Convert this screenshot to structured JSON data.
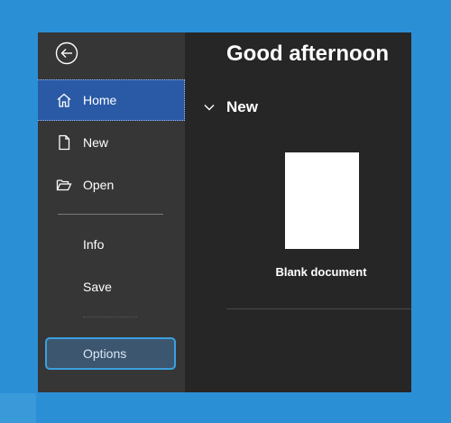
{
  "colors": {
    "page_background": "#2b8fd6",
    "sidebar_background": "#363636",
    "main_background": "#262626",
    "active_item": "#2a5aa6",
    "options_highlight_border": "#3aa0e0"
  },
  "sidebar": {
    "back_icon": "back-arrow-circle-icon",
    "items": [
      {
        "label": "Home",
        "icon": "home-icon"
      },
      {
        "label": "New",
        "icon": "new-document-icon"
      },
      {
        "label": "Open",
        "icon": "open-folder-icon"
      }
    ],
    "secondary_items": [
      {
        "label": "Info"
      },
      {
        "label": "Save"
      }
    ],
    "options_label": "Options"
  },
  "main": {
    "greeting": "Good afternoon",
    "new_section": {
      "title": "New",
      "chevron_icon": "chevron-down-icon",
      "templates": [
        {
          "label": "Blank document"
        }
      ]
    }
  }
}
